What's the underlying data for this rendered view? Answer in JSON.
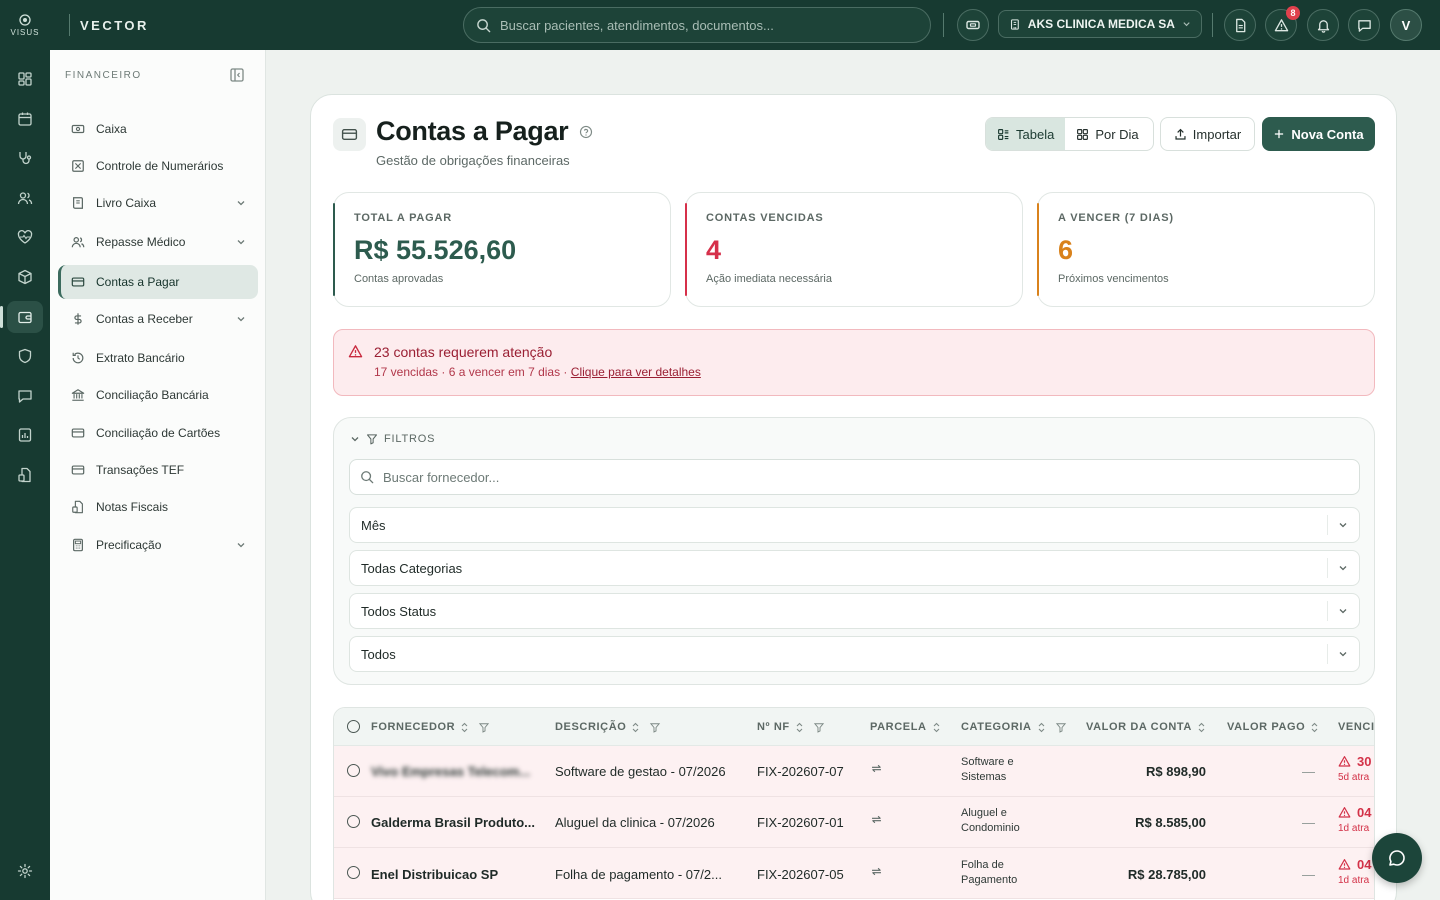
{
  "app": {
    "brand": "VECTOR",
    "logo_text": "VISUS"
  },
  "topbar": {
    "search_placeholder": "Buscar pacientes, atendimentos, documentos...",
    "clinic": "AKS CLINICA MEDICA SA",
    "alerts_count": "8",
    "avatar": "V"
  },
  "sidebar": {
    "section": "FINANCEIRO",
    "items": [
      {
        "label": "Caixa",
        "icon": "cash-register-icon"
      },
      {
        "label": "Controle de Numerários",
        "icon": "grid-x-icon"
      },
      {
        "label": "Livro Caixa",
        "icon": "ledger-icon",
        "expandable": true
      },
      {
        "label": "Repasse Médico",
        "icon": "users-icon",
        "expandable": true
      },
      {
        "label": "Contas a Pagar",
        "icon": "card-icon",
        "active": true
      },
      {
        "label": "Contas a Receber",
        "icon": "dollar-icon",
        "expandable": true
      },
      {
        "label": "Extrato Bancário",
        "icon": "history-icon"
      },
      {
        "label": "Conciliação Bancária",
        "icon": "bank-icon"
      },
      {
        "label": "Conciliação de Cartões",
        "icon": "card-icon"
      },
      {
        "label": "Transações TEF",
        "icon": "card-icon"
      },
      {
        "label": "Notas Fiscais",
        "icon": "invoice-icon"
      },
      {
        "label": "Precificação",
        "icon": "calculator-icon",
        "expandable": true
      }
    ]
  },
  "page": {
    "title": "Contas a Pagar",
    "subtitle": "Gestão de obrigações financeiras",
    "view_table": "Tabela",
    "view_day": "Por Dia",
    "import": "Importar",
    "new": "Nova Conta"
  },
  "stats": [
    {
      "label": "TOTAL A PAGAR",
      "value": "R$ 55.526,60",
      "note": "Contas aprovadas",
      "color": "#2d5b4e"
    },
    {
      "label": "CONTAS VENCIDAS",
      "value": "4",
      "note": "Ação imediata necessária",
      "color": "#d6304a"
    },
    {
      "label": "A VENCER (7 DIAS)",
      "value": "6",
      "note": "Próximos vencimentos",
      "color": "#d9821c"
    }
  ],
  "alert": {
    "title": "23 contas requerem atenção",
    "summary": "17 vencidas · 6 a vencer em 7 dias ·",
    "link": "Clique para ver detalhes"
  },
  "filters": {
    "title": "FILTROS",
    "search_placeholder": "Buscar fornecedor...",
    "month": "Mês",
    "category": "Todas Categorias",
    "status": "Todos Status",
    "type": "Todos"
  },
  "table": {
    "headers": {
      "supplier": "FORNECEDOR",
      "description": "DESCRIÇÃO",
      "nf": "Nº NF",
      "installment": "PARCELA",
      "category": "CATEGORIA",
      "amount": "VALOR DA CONTA",
      "paid": "VALOR PAGO",
      "due": "VENCI"
    },
    "rows": [
      {
        "supplier": "Vivo Empresas Telecom...",
        "description": "Software de gestao - 07/2026",
        "nf": "FIX-202607-07",
        "cat1": "Software e",
        "cat2": "Sistemas",
        "amount": "R$ 898,90",
        "paid": "—",
        "due": "30",
        "late": "5d atra"
      },
      {
        "supplier": "Galderma Brasil Produto...",
        "description": "Aluguel da clinica - 07/2026",
        "nf": "FIX-202607-01",
        "cat1": "Aluguel e",
        "cat2": "Condominio",
        "amount": "R$ 8.585,00",
        "paid": "—",
        "due": "04",
        "late": "1d atra"
      },
      {
        "supplier": "Enel Distribuicao SP",
        "description": "Folha de pagamento - 07/2...",
        "nf": "FIX-202607-05",
        "cat1": "Folha de",
        "cat2": "Pagamento",
        "amount": "R$ 28.785,00",
        "paid": "—",
        "due": "04",
        "late": "1d atra"
      }
    ]
  }
}
